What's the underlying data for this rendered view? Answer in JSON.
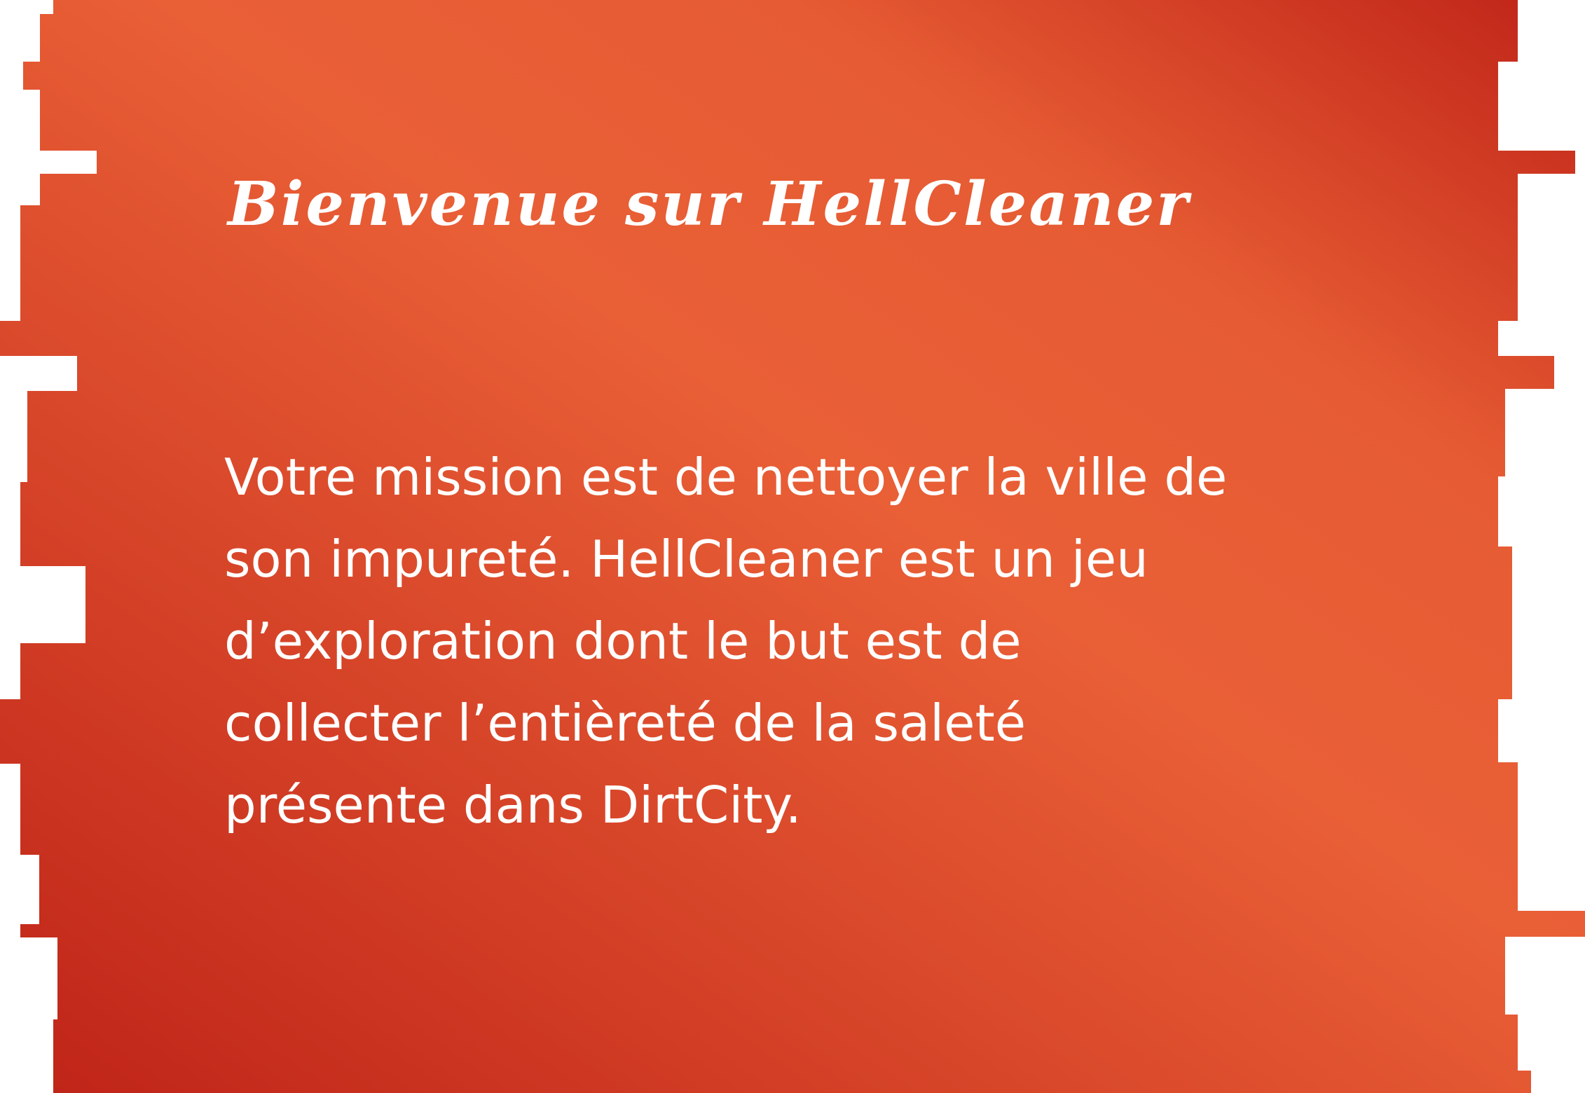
{
  "panel": {
    "title": "Bienvenue sur HellCleaner",
    "body_lines": [
      "Votre mission est de nettoyer la ville de",
      "son impureté. HellCleaner est un jeu",
      "d’exploration dont le but est de",
      "collecter l’entièreté de la saleté",
      "présente dans DirtCity."
    ],
    "colors": {
      "gradient_dark": "#bf2318",
      "gradient_light": "#e95f36",
      "text": "#ffffff"
    }
  }
}
